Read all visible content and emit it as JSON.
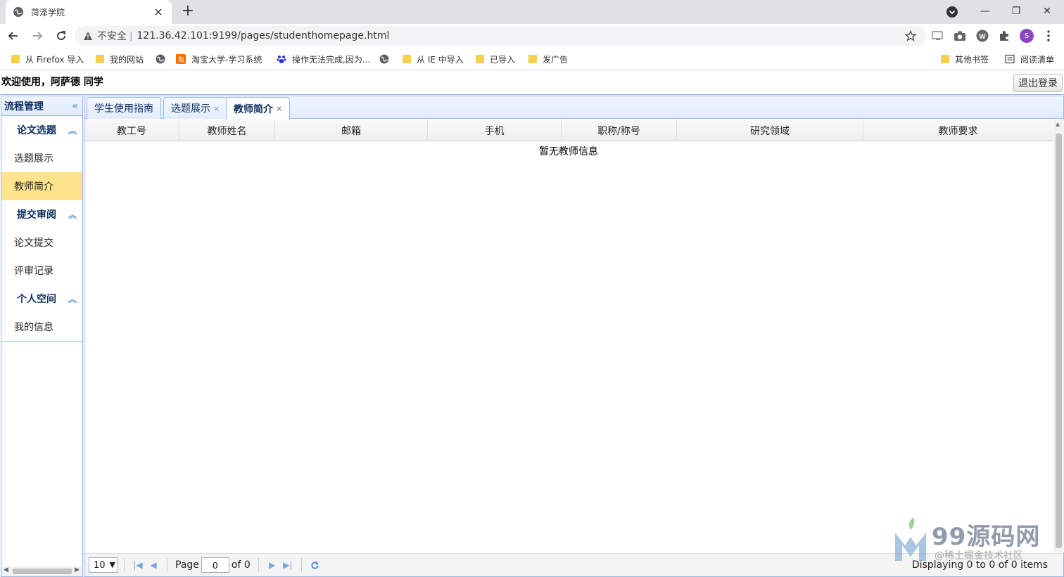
{
  "browser": {
    "tab_title": "菏泽学院",
    "address_insecure": "不安全",
    "address_sep": "|",
    "url": "121.36.42.101:9199/pages/studenthomepage.html",
    "profile_initial": "S",
    "bookmarks": [
      {
        "label": "从 Firefox 导入",
        "icon": "folder-icon"
      },
      {
        "label": "我的网站",
        "icon": "folder-icon"
      },
      {
        "label": "",
        "icon": "globe-icon"
      },
      {
        "label": "淘宝大学-学习系统",
        "icon": "taobao-icon"
      },
      {
        "label": "操作无法完成,因为...",
        "icon": "baidu-icon"
      },
      {
        "label": "",
        "icon": "globe-icon"
      },
      {
        "label": "从 IE 中导入",
        "icon": "folder-icon"
      },
      {
        "label": "已导入",
        "icon": "folder-icon"
      },
      {
        "label": "发广告",
        "icon": "folder-icon"
      }
    ],
    "other_bookmarks": "其他书签",
    "reading_list": "阅读清单"
  },
  "app": {
    "welcome": "欢迎使用，阿萨德 同学",
    "logout": "退出登录"
  },
  "west": {
    "title": "流程管理",
    "collapse_glyph": "«",
    "groups": [
      {
        "title": "论文选题",
        "items": [
          "选题展示",
          "教师简介"
        ]
      },
      {
        "title": "提交审阅",
        "items": [
          "论文提交",
          "评审记录"
        ]
      },
      {
        "title": "个人空间",
        "items": [
          "我的信息"
        ]
      }
    ],
    "active_item": "教师简介"
  },
  "tabs": [
    {
      "label": "学生使用指南",
      "closable": false
    },
    {
      "label": "选题展示",
      "closable": true
    },
    {
      "label": "教师简介",
      "closable": true,
      "selected": true
    }
  ],
  "tab_close_glyph": "×",
  "grid": {
    "columns": [
      "教工号",
      "教师姓名",
      "邮箱",
      "手机",
      "职称/称号",
      "研究领域",
      "教师要求"
    ],
    "empty_message": "暂无教师信息"
  },
  "pager": {
    "page_size": "10",
    "page_label": "Page",
    "page_value": "0",
    "of_label": "of 0",
    "display_info": "Displaying 0 to 0 of 0 items"
  },
  "watermark": {
    "brand": "99源码网",
    "sub": "@稀土掘金技术社区"
  }
}
